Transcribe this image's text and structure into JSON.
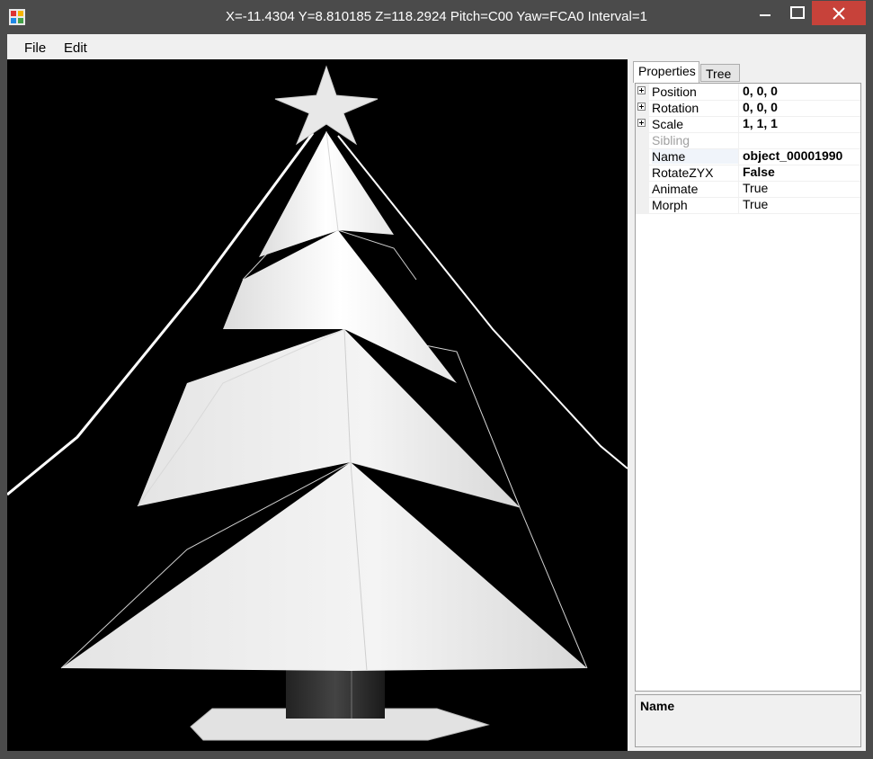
{
  "window": {
    "title": "X=-11.4304 Y=8.810185 Z=118.2924 Pitch=C00 Yaw=FCA0 Interval=1",
    "minimize_glyph": "—",
    "maximize_glyph": "☐",
    "close_glyph": "✕"
  },
  "menu": {
    "file": "File",
    "edit": "Edit"
  },
  "viewport": {
    "background": "#000000",
    "model_color": "#f2f2f2"
  },
  "panel": {
    "tabs": [
      {
        "label": "Properties",
        "active": true
      },
      {
        "label": "Tree",
        "active": false
      }
    ],
    "properties": [
      {
        "name": "Position",
        "value": "0, 0, 0",
        "expandable": true,
        "bold": true
      },
      {
        "name": "Rotation",
        "value": "0, 0, 0",
        "expandable": true,
        "bold": true
      },
      {
        "name": "Scale",
        "value": "1, 1, 1",
        "expandable": true,
        "bold": true
      },
      {
        "name": "Sibling",
        "value": "",
        "expandable": false,
        "bold": false,
        "disabled": true
      },
      {
        "name": "Name",
        "value": "object_00001990",
        "expandable": false,
        "bold": true,
        "selected": true
      },
      {
        "name": "RotateZYX",
        "value": "False",
        "expandable": false,
        "bold": true
      },
      {
        "name": "Animate",
        "value": "True",
        "expandable": false,
        "bold": false
      },
      {
        "name": "Morph",
        "value": "True",
        "expandable": false,
        "bold": false
      }
    ],
    "help_title": "Name"
  }
}
